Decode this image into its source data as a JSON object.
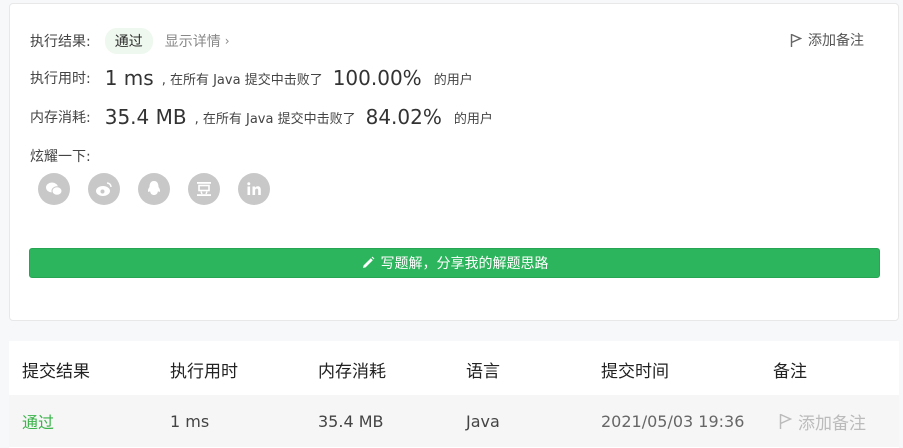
{
  "summary": {
    "result_label": "执行结果:",
    "result_value": "通过",
    "details_link": "显示详情",
    "add_note": "添加备注",
    "runtime_label": "执行用时:",
    "runtime_value": "1 ms",
    "runtime_text": ", 在所有 Java 提交中击败了",
    "runtime_pct": "100.00%",
    "runtime_suffix": "的用户",
    "memory_label": "内存消耗:",
    "memory_value": "35.4 MB",
    "memory_text": ", 在所有 Java 提交中击败了",
    "memory_pct": "84.02%",
    "memory_suffix": "的用户",
    "share_label": "炫耀一下:",
    "share_icons": [
      "wechat-icon",
      "weibo-icon",
      "qq-icon",
      "douban-icon",
      "linkedin-icon"
    ],
    "write_button": "写题解，分享我的解题思路"
  },
  "table": {
    "headers": [
      "提交结果",
      "执行用时",
      "内存消耗",
      "语言",
      "提交时间",
      "备注"
    ],
    "rows": [
      {
        "status": "通过",
        "runtime": "1 ms",
        "memory": "35.4 MB",
        "language": "Java",
        "time": "2021/05/03 19:36",
        "note": "添加备注"
      }
    ]
  },
  "colors": {
    "accent": "#2db55d",
    "pass": "#3bb34a",
    "icon_gray": "#c8c8c8"
  }
}
